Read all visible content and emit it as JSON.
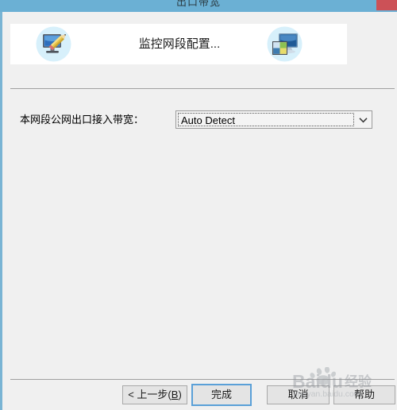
{
  "window": {
    "title": "出口带宽",
    "close_icon": "close-button-red"
  },
  "header": {
    "title": "监控网段配置...",
    "left_icon": "monitor-pencil-icon",
    "right_icon": "monitor-network-icon"
  },
  "form": {
    "bandwidth": {
      "label": "本网段公网出口接入带宽：",
      "value": "Auto Detect",
      "placeholder": "Auto Detect",
      "arrow_icon": "chevron-down-icon"
    }
  },
  "buttons": {
    "back": "< 上一步(B)",
    "back_prefix": "< 上一步(",
    "back_mnemonic": "B",
    "back_suffix": ")",
    "finish": "完成",
    "cancel": "取消",
    "help": "帮助"
  },
  "watermark": {
    "brand": "Baidu",
    "sub": "经验",
    "url": "jingyan.baidu.com"
  },
  "colors": {
    "titlebar": "#6bb0d4",
    "close": "#cc5157",
    "accent": "#5aa0d8",
    "window_bg": "#f0f0f0",
    "panel_bg": "#ffffff"
  }
}
